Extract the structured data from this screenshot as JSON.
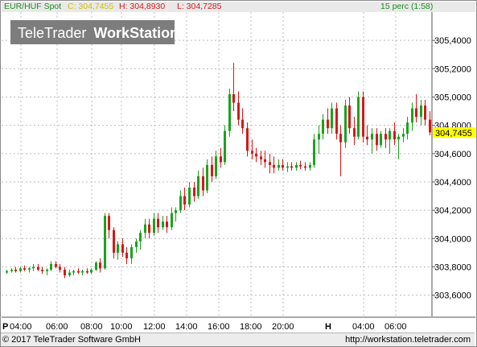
{
  "header": {
    "symbol": "EUR/HUF Spot",
    "close_label": "C: 304,7455",
    "high_label": "H: 304,8930",
    "low_label": "L: 304,7285",
    "interval": "15 perc (1:58)",
    "colors": {
      "symbol": "#1f8a1f",
      "close": "#d4c000",
      "high": "#d01a1a",
      "low": "#d01a1a",
      "interval": "#1f8a1f"
    }
  },
  "watermark": {
    "text_light": "TeleTrader",
    "text_bold": "WorkStation"
  },
  "footer": {
    "copyright": "© 2017 TeleTrader Software GmbH",
    "url": "http://workstation.teletrader.com"
  },
  "last_price_label": "304,7455",
  "colors": {
    "up": "#1fa01f",
    "down": "#d01a1a",
    "grid": "#bdbdbd",
    "last_price_bg": "#ffff00"
  },
  "chart_data": {
    "type": "candlestick",
    "ylim": [
      303.45,
      305.6
    ],
    "ytick_values": [
      303.6,
      303.8,
      304.0,
      304.2,
      304.4,
      304.6,
      304.8,
      305.0,
      305.2,
      305.4
    ],
    "ytick_labels": [
      "303,6000",
      "303,8000",
      "304,0000",
      "304,2000",
      "304,4000",
      "304,6000",
      "304,8000",
      "305,0000",
      "305,2000",
      "305,4000"
    ],
    "xtick_labels": [
      "P",
      "04:00",
      "06:00",
      "08:00",
      "10:00",
      "12:00",
      "14:00",
      "16:00",
      "18:00",
      "20:00",
      "H",
      "04:00",
      "06:00"
    ],
    "last_price": 304.7455,
    "ohlc": [
      [
        303.76,
        303.78,
        303.75,
        303.77
      ],
      [
        303.77,
        303.79,
        303.76,
        303.78
      ],
      [
        303.78,
        303.8,
        303.76,
        303.77
      ],
      [
        303.77,
        303.8,
        303.76,
        303.79
      ],
      [
        303.79,
        303.81,
        303.77,
        303.78
      ],
      [
        303.78,
        303.8,
        303.76,
        303.79
      ],
      [
        303.79,
        303.82,
        303.77,
        303.8
      ],
      [
        303.8,
        303.82,
        303.77,
        303.78
      ],
      [
        303.78,
        303.8,
        303.75,
        303.77
      ],
      [
        303.77,
        303.79,
        303.74,
        303.78
      ],
      [
        303.78,
        303.84,
        303.77,
        303.82
      ],
      [
        303.82,
        303.84,
        303.79,
        303.8
      ],
      [
        303.8,
        303.82,
        303.76,
        303.78
      ],
      [
        303.78,
        303.8,
        303.72,
        303.74
      ],
      [
        303.74,
        303.78,
        303.73,
        303.76
      ],
      [
        303.76,
        303.78,
        303.74,
        303.77
      ],
      [
        303.77,
        303.79,
        303.75,
        303.76
      ],
      [
        303.76,
        303.78,
        303.74,
        303.77
      ],
      [
        303.77,
        303.79,
        303.75,
        303.76
      ],
      [
        303.76,
        303.79,
        303.75,
        303.78
      ],
      [
        303.78,
        303.84,
        303.77,
        303.83
      ],
      [
        303.83,
        303.86,
        303.76,
        303.79
      ],
      [
        303.79,
        304.18,
        303.78,
        304.16
      ],
      [
        304.16,
        304.18,
        304.0,
        304.06
      ],
      [
        304.06,
        304.08,
        303.86,
        303.9
      ],
      [
        303.9,
        303.98,
        303.85,
        303.96
      ],
      [
        303.96,
        304.0,
        303.87,
        303.9
      ],
      [
        303.9,
        303.94,
        303.82,
        303.86
      ],
      [
        303.86,
        303.96,
        303.82,
        303.94
      ],
      [
        303.94,
        304.0,
        303.9,
        303.98
      ],
      [
        303.98,
        304.06,
        303.92,
        304.04
      ],
      [
        304.04,
        304.14,
        304.0,
        304.1
      ],
      [
        304.1,
        304.14,
        304.0,
        304.04
      ],
      [
        304.04,
        304.18,
        304.02,
        304.14
      ],
      [
        304.14,
        304.18,
        304.04,
        304.08
      ],
      [
        304.08,
        304.16,
        304.06,
        304.12
      ],
      [
        304.12,
        304.16,
        304.04,
        304.08
      ],
      [
        304.08,
        304.22,
        304.06,
        304.18
      ],
      [
        304.18,
        304.22,
        304.12,
        304.2
      ],
      [
        304.2,
        304.34,
        304.18,
        304.3
      ],
      [
        304.3,
        304.36,
        304.2,
        304.24
      ],
      [
        304.24,
        304.4,
        304.22,
        304.36
      ],
      [
        304.36,
        304.4,
        304.26,
        304.3
      ],
      [
        304.3,
        304.48,
        304.28,
        304.44
      ],
      [
        304.44,
        304.5,
        304.3,
        304.34
      ],
      [
        304.34,
        304.56,
        304.32,
        304.52
      ],
      [
        304.52,
        304.58,
        304.4,
        304.44
      ],
      [
        304.44,
        304.62,
        304.42,
        304.58
      ],
      [
        304.58,
        304.64,
        304.5,
        304.54
      ],
      [
        304.54,
        304.8,
        304.52,
        304.76
      ],
      [
        304.76,
        305.06,
        304.72,
        305.02
      ],
      [
        305.02,
        305.24,
        304.9,
        304.96
      ],
      [
        304.96,
        305.04,
        304.8,
        304.84
      ],
      [
        304.84,
        304.92,
        304.74,
        304.78
      ],
      [
        304.78,
        304.82,
        304.58,
        304.62
      ],
      [
        304.62,
        304.7,
        304.56,
        304.6
      ],
      [
        304.6,
        304.64,
        304.54,
        304.58
      ],
      [
        304.58,
        304.62,
        304.52,
        304.56
      ],
      [
        304.56,
        304.62,
        304.5,
        304.54
      ],
      [
        304.54,
        304.6,
        304.46,
        304.52
      ],
      [
        304.52,
        304.58,
        304.46,
        304.5
      ],
      [
        304.5,
        304.56,
        304.48,
        304.52
      ],
      [
        304.52,
        304.56,
        304.48,
        304.5
      ],
      [
        304.5,
        304.54,
        304.47,
        304.51
      ],
      [
        304.51,
        304.54,
        304.48,
        304.5
      ],
      [
        304.5,
        304.54,
        304.48,
        304.52
      ],
      [
        304.52,
        304.55,
        304.49,
        304.51
      ],
      [
        304.51,
        304.54,
        304.48,
        304.5
      ],
      [
        304.5,
        304.54,
        304.48,
        304.52
      ],
      [
        304.52,
        304.74,
        304.5,
        304.7
      ],
      [
        304.7,
        304.8,
        304.6,
        304.74
      ],
      [
        304.74,
        304.88,
        304.7,
        304.84
      ],
      [
        304.84,
        304.92,
        304.74,
        304.78
      ],
      [
        304.78,
        304.96,
        304.74,
        304.92
      ],
      [
        304.92,
        304.96,
        304.7,
        304.74
      ],
      [
        304.74,
        304.8,
        304.44,
        304.68
      ],
      [
        304.68,
        304.98,
        304.64,
        304.94
      ],
      [
        304.94,
        305.0,
        304.74,
        304.78
      ],
      [
        304.78,
        304.86,
        304.66,
        304.72
      ],
      [
        304.72,
        305.04,
        304.7,
        305.0
      ],
      [
        305.0,
        305.04,
        304.68,
        304.72
      ],
      [
        304.72,
        304.8,
        304.66,
        304.7
      ],
      [
        304.7,
        304.78,
        304.6,
        304.74
      ],
      [
        304.74,
        304.78,
        304.62,
        304.66
      ],
      [
        304.66,
        304.76,
        304.64,
        304.74
      ],
      [
        304.74,
        304.78,
        304.64,
        304.7
      ],
      [
        304.7,
        304.78,
        304.6,
        304.76
      ],
      [
        304.76,
        304.82,
        304.66,
        304.7
      ],
      [
        304.7,
        304.74,
        304.56,
        304.72
      ],
      [
        304.72,
        304.78,
        304.68,
        304.74
      ],
      [
        304.74,
        304.86,
        304.7,
        304.82
      ],
      [
        304.82,
        304.96,
        304.76,
        304.92
      ],
      [
        304.92,
        305.02,
        304.82,
        304.86
      ],
      [
        304.86,
        304.98,
        304.8,
        304.94
      ],
      [
        304.94,
        304.98,
        304.8,
        304.84
      ],
      [
        304.84,
        304.9,
        304.73,
        304.75
      ]
    ]
  }
}
